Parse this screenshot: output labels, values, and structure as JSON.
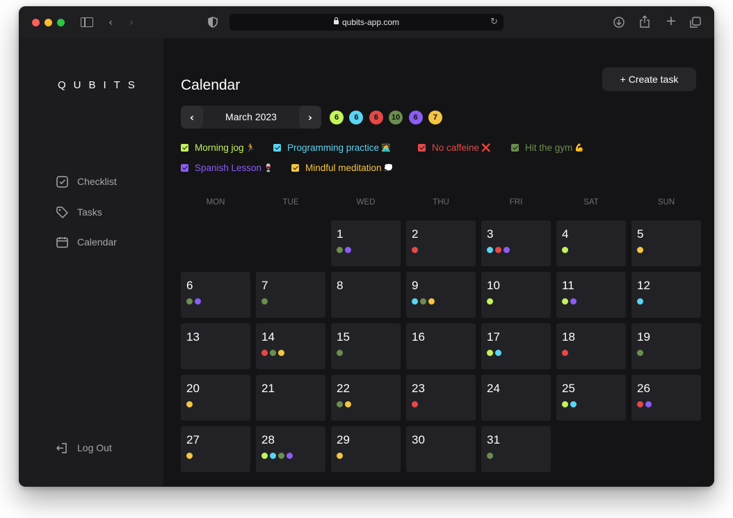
{
  "browser": {
    "url": "qubits-app.com"
  },
  "sidebar": {
    "logo": "QUBITS",
    "items": [
      {
        "label": "Checklist",
        "icon": "checkbox-icon"
      },
      {
        "label": "Tasks",
        "icon": "tag-icon"
      },
      {
        "label": "Calendar",
        "icon": "calendar-icon"
      }
    ],
    "logout": "Log Out"
  },
  "header": {
    "title": "Calendar",
    "create_label": "+ Create task"
  },
  "month_nav": {
    "label": "March 2023",
    "prev": "‹",
    "next": "›"
  },
  "habit_counts": [
    {
      "value": "6",
      "color": "#c4f35a"
    },
    {
      "value": "6",
      "color": "#5ad4f3"
    },
    {
      "value": "6",
      "color": "#e54848"
    },
    {
      "value": "10",
      "color": "#6b8e4e"
    },
    {
      "value": "6",
      "color": "#8b5cf6"
    },
    {
      "value": "7",
      "color": "#f5c542"
    }
  ],
  "habits": [
    {
      "label": "Morning jog",
      "emoji": "🏃",
      "color": "#c4f35a",
      "checked": true
    },
    {
      "label": "Programming practice",
      "emoji": "👩‍💻",
      "color": "#5ad4f3",
      "checked": true
    },
    {
      "label": "No caffeine",
      "emoji": "❌",
      "color": "#e54848",
      "checked": true
    },
    {
      "label": "Hit the gym",
      "emoji": "💪",
      "color": "#6b8e4e",
      "checked": true
    },
    {
      "label": "Spanish Lesson",
      "emoji": "🍷",
      "color": "#8b5cf6",
      "checked": true
    },
    {
      "label": "Mindful meditation",
      "emoji": "💭",
      "color": "#f5c542",
      "checked": true
    }
  ],
  "weekdays": [
    "MON",
    "TUE",
    "WED",
    "THU",
    "FRI",
    "SAT",
    "SUN"
  ],
  "days": [
    {
      "day": "1",
      "dots": [
        "#6b8e4e",
        "#8b5cf6"
      ]
    },
    {
      "day": "2",
      "dots": [
        "#e54848"
      ]
    },
    {
      "day": "3",
      "dots": [
        "#5ad4f3",
        "#e54848",
        "#8b5cf6"
      ]
    },
    {
      "day": "4",
      "dots": [
        "#c4f35a"
      ]
    },
    {
      "day": "5",
      "dots": [
        "#f5c542"
      ]
    },
    {
      "day": "6",
      "dots": [
        "#6b8e4e",
        "#8b5cf6"
      ]
    },
    {
      "day": "7",
      "dots": [
        "#6b8e4e"
      ]
    },
    {
      "day": "8",
      "dots": []
    },
    {
      "day": "9",
      "dots": [
        "#5ad4f3",
        "#6b8e4e",
        "#f5c542"
      ]
    },
    {
      "day": "10",
      "dots": [
        "#c4f35a"
      ]
    },
    {
      "day": "11",
      "dots": [
        "#c4f35a",
        "#8b5cf6"
      ]
    },
    {
      "day": "12",
      "dots": [
        "#5ad4f3"
      ]
    },
    {
      "day": "13",
      "dots": []
    },
    {
      "day": "14",
      "dots": [
        "#e54848",
        "#6b8e4e",
        "#f5c542"
      ]
    },
    {
      "day": "15",
      "dots": [
        "#6b8e4e"
      ]
    },
    {
      "day": "16",
      "dots": []
    },
    {
      "day": "17",
      "dots": [
        "#c4f35a",
        "#5ad4f3"
      ]
    },
    {
      "day": "18",
      "dots": [
        "#e54848"
      ]
    },
    {
      "day": "19",
      "dots": [
        "#6b8e4e"
      ]
    },
    {
      "day": "20",
      "dots": [
        "#f5c542"
      ]
    },
    {
      "day": "21",
      "dots": []
    },
    {
      "day": "22",
      "dots": [
        "#6b8e4e",
        "#f5c542"
      ]
    },
    {
      "day": "23",
      "dots": [
        "#e54848"
      ]
    },
    {
      "day": "24",
      "dots": []
    },
    {
      "day": "25",
      "dots": [
        "#c4f35a",
        "#5ad4f3"
      ]
    },
    {
      "day": "26",
      "dots": [
        "#e54848",
        "#8b5cf6"
      ]
    },
    {
      "day": "27",
      "dots": [
        "#f5c542"
      ]
    },
    {
      "day": "28",
      "dots": [
        "#c4f35a",
        "#5ad4f3",
        "#6b8e4e",
        "#8b5cf6"
      ]
    },
    {
      "day": "29",
      "dots": [
        "#f5c542"
      ]
    },
    {
      "day": "30",
      "dots": []
    },
    {
      "day": "31",
      "dots": [
        "#6b8e4e"
      ]
    }
  ]
}
